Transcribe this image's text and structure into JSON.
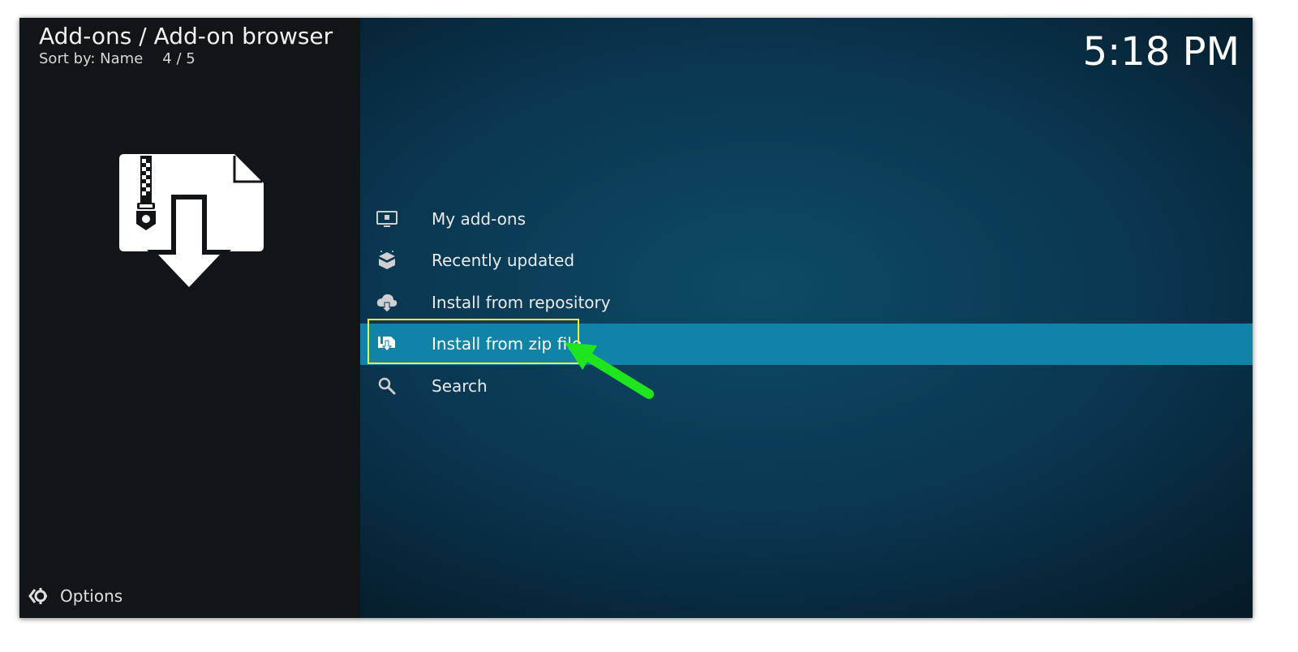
{
  "header": {
    "breadcrumb": "Add-ons / Add-on browser",
    "sort_label": "Sort by: Name",
    "sort_separator": "",
    "page_position": "4 / 5"
  },
  "clock": "5:18 PM",
  "menu": {
    "items": [
      {
        "label": "My add-ons",
        "icon": "monitor-box-icon"
      },
      {
        "label": "Recently updated",
        "icon": "open-box-icon"
      },
      {
        "label": "Install from repository",
        "icon": "cloud-download-icon"
      },
      {
        "label": "Install from zip file",
        "icon": "zip-download-icon",
        "selected": true
      },
      {
        "label": "Search",
        "icon": "search-icon"
      }
    ]
  },
  "footer": {
    "options_label": "Options"
  },
  "colors": {
    "selected_row": "#0f84a6",
    "annotation_box": "#f5ee2b",
    "annotation_arrow": "#1fe51f"
  }
}
